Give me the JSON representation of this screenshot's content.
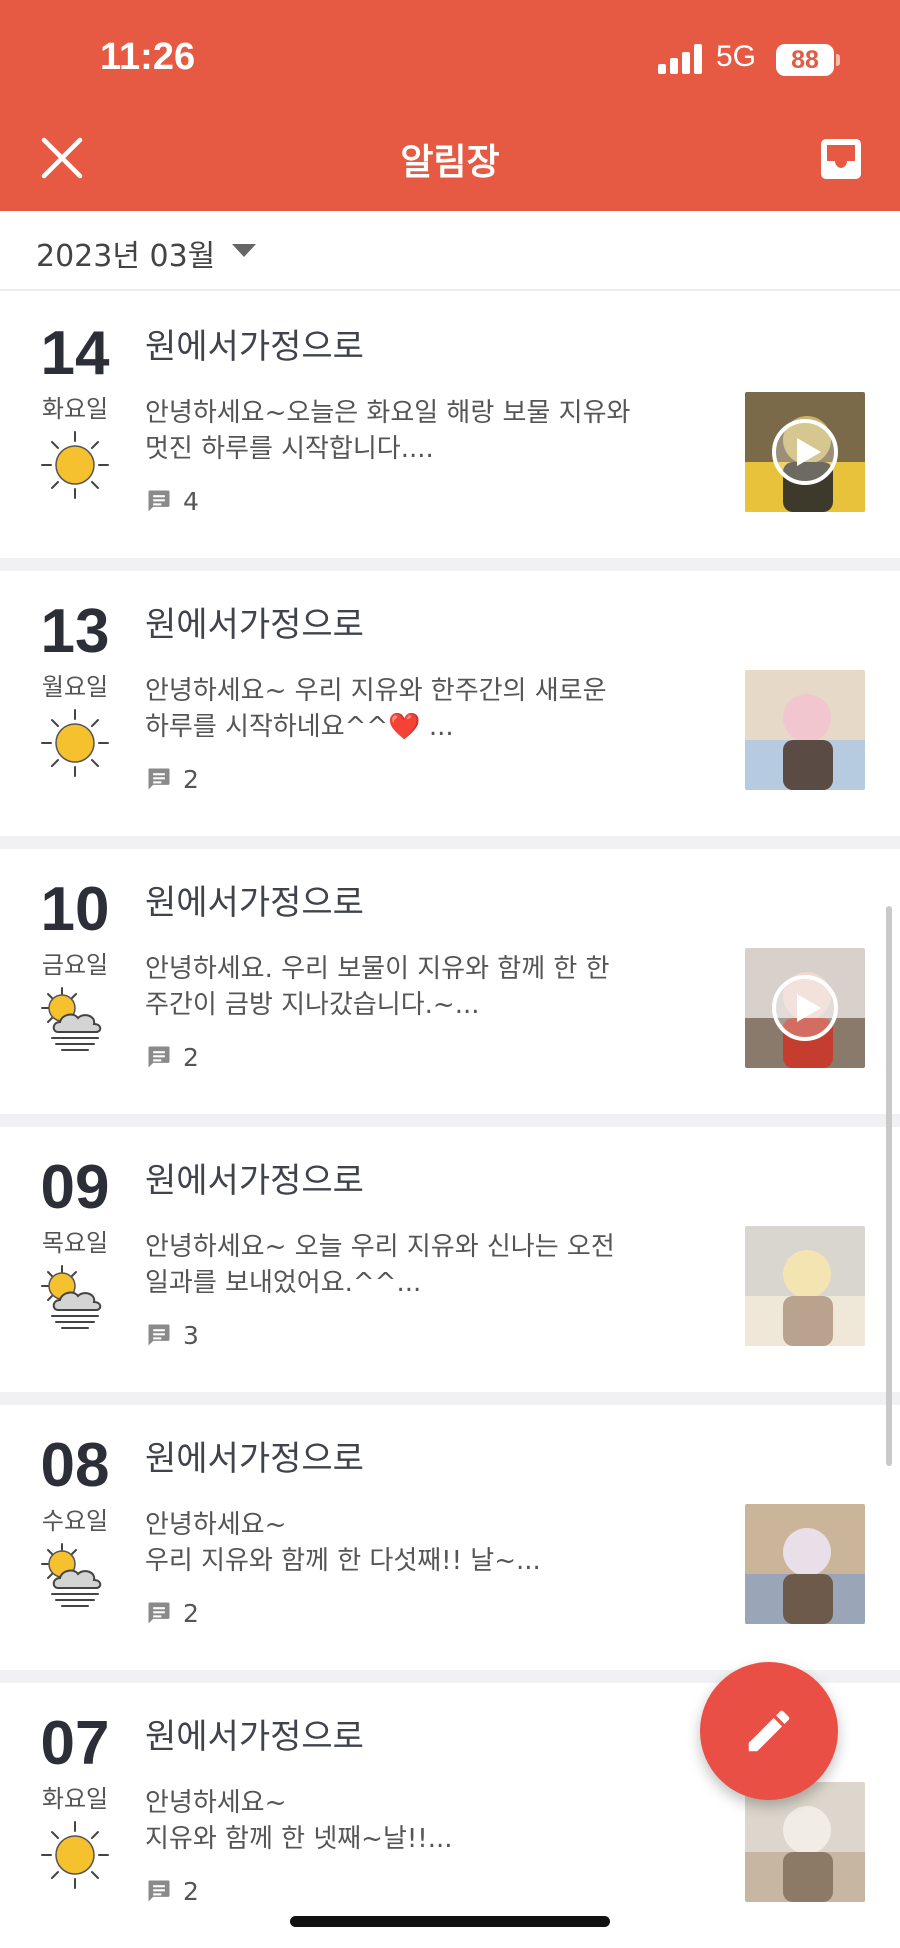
{
  "status_bar": {
    "time": "11:26",
    "network": "5G",
    "battery": "88"
  },
  "header": {
    "title": "알림장",
    "close_icon": "close-icon",
    "inbox_icon": "inbox-icon"
  },
  "month_selector": {
    "label": "2023년 03월"
  },
  "notices": [
    {
      "day": "14",
      "weekday": "화요일",
      "weather": "sunny",
      "title": "원에서가정으로",
      "line1": "안녕하세요~오늘은 화요일 해랑 보물 지유와",
      "line2": "멋진 하루를 시작합니다....",
      "comments": "4",
      "video": true
    },
    {
      "day": "13",
      "weekday": "월요일",
      "weather": "sunny",
      "title": "원에서가정으로",
      "line1": "안녕하세요~ 우리 지유와 한주간의 새로운",
      "line2": "하루를 시작하네요^^❤️ ...",
      "comments": "2",
      "video": false
    },
    {
      "day": "10",
      "weekday": "금요일",
      "weather": "sun-behind-fog",
      "title": "원에서가정으로",
      "line1": "안녕하세요. 우리 보물이 지유와 함께 한 한",
      "line2": "주간이 금방 지나갔습니다.~...",
      "comments": "2",
      "video": true
    },
    {
      "day": "09",
      "weekday": "목요일",
      "weather": "sun-behind-fog",
      "title": "원에서가정으로",
      "line1": "안녕하세요~ 오늘 우리 지유와 신나는 오전",
      "line2": "일과를 보내었어요.^^...",
      "comments": "3",
      "video": false
    },
    {
      "day": "08",
      "weekday": "수요일",
      "weather": "sun-behind-fog",
      "title": "원에서가정으로",
      "line1": "안녕하세요~",
      "line2": "우리 지유와 함께 한 다섯째!! 날~...",
      "comments": "2",
      "video": false
    },
    {
      "day": "07",
      "weekday": "화요일",
      "weather": "sunny",
      "title": "원에서가정으로",
      "line1": "안녕하세요~",
      "line2": "지유와 함께 한 넷째~날!!...",
      "comments": "2",
      "video": false
    }
  ],
  "fab": {
    "icon": "pencil-icon"
  },
  "colors": {
    "accent": "#e65a43",
    "fab": "#e94f44",
    "sun": "#f5c12e"
  }
}
